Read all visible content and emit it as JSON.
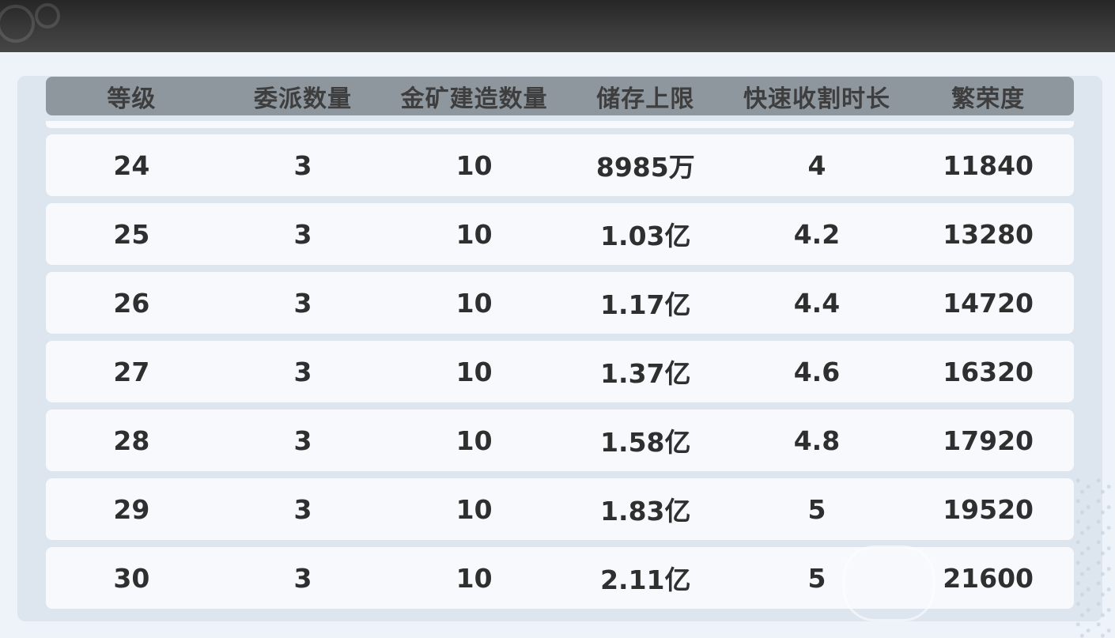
{
  "table": {
    "headers": [
      "等级",
      "委派数量",
      "金矿建造数量",
      "储存上限",
      "快速收割时长",
      "繁荣度"
    ],
    "rows": [
      [
        "24",
        "3",
        "10",
        "8985万",
        "4",
        "11840"
      ],
      [
        "25",
        "3",
        "10",
        "1.03亿",
        "4.2",
        "13280"
      ],
      [
        "26",
        "3",
        "10",
        "1.17亿",
        "4.4",
        "14720"
      ],
      [
        "27",
        "3",
        "10",
        "1.37亿",
        "4.6",
        "16320"
      ],
      [
        "28",
        "3",
        "10",
        "1.58亿",
        "4.8",
        "17920"
      ],
      [
        "29",
        "3",
        "10",
        "1.83亿",
        "5",
        "19520"
      ],
      [
        "30",
        "3",
        "10",
        "2.11亿",
        "5",
        "21600"
      ]
    ]
  },
  "colors": {
    "header_bg": "#8e969e",
    "row_bg": "#f7f9fc",
    "panel_bg": "#dde5ee",
    "text": "#2f2f2f"
  }
}
